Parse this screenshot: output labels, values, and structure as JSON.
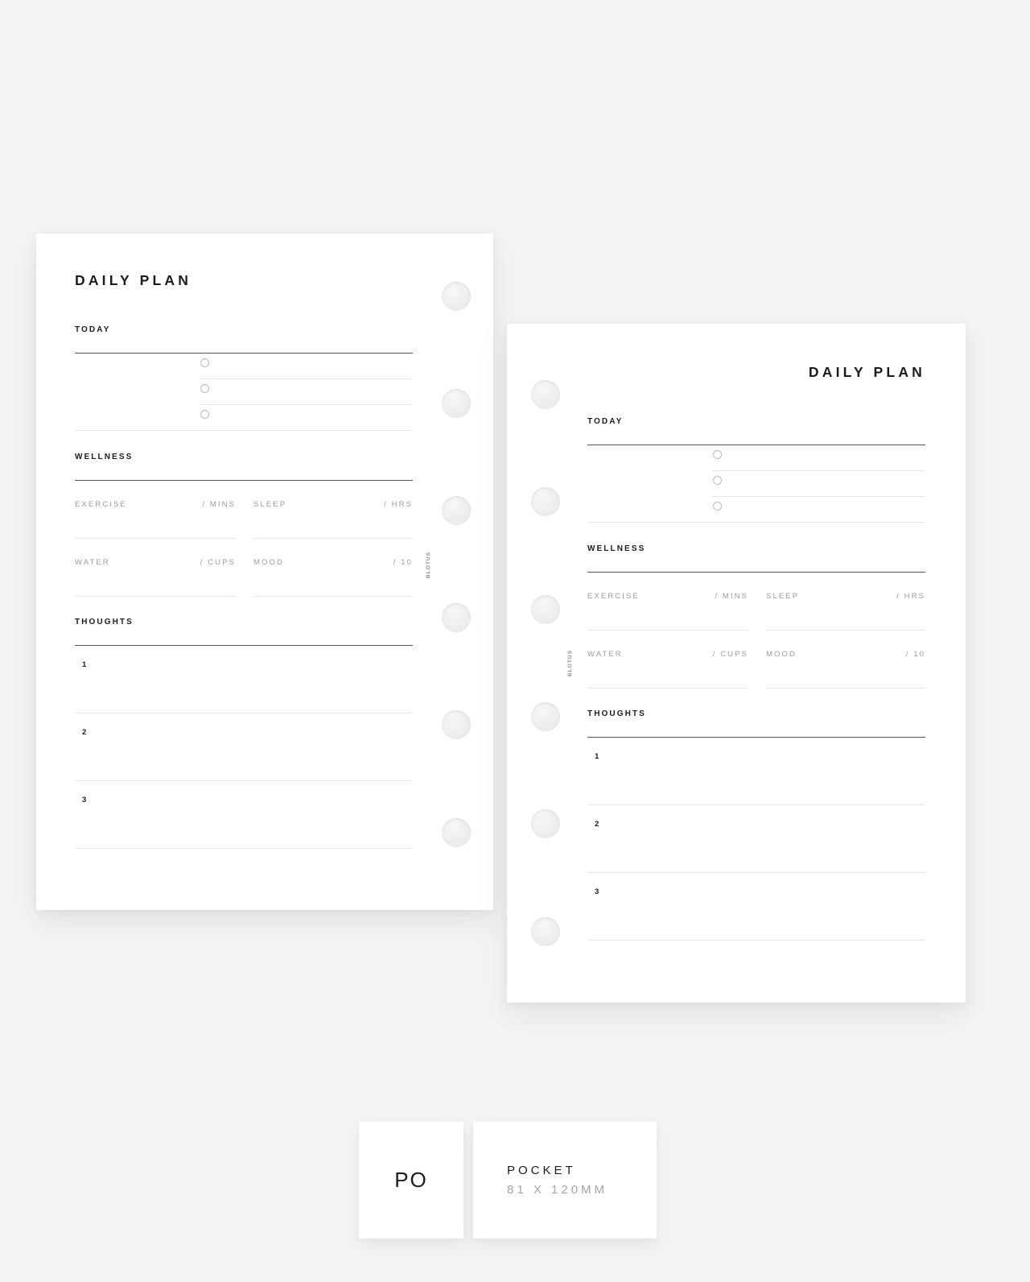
{
  "background_color": "#f5f4f3",
  "page_color": "#ffffff",
  "accent_rule_color": "#555555",
  "soft_rule_color": "#e6e6e6",
  "muted_text_color": "#9b9b9b",
  "pages": [
    {
      "id": "left",
      "title": "DAILY PLAN",
      "title_align": "left",
      "brand": "BLOTUS",
      "holes": 6,
      "sections": {
        "today": {
          "label": "TODAY",
          "rows": [
            {
              "checkbox": "radio-unchecked"
            },
            {
              "checkbox": "radio-unchecked"
            },
            {
              "checkbox": "radio-unchecked"
            }
          ]
        },
        "wellness": {
          "label": "WELLNESS",
          "fields": [
            {
              "label": "EXERCISE",
              "unit": "/ MINS"
            },
            {
              "label": "SLEEP",
              "unit": "/ HRS"
            },
            {
              "label": "WATER",
              "unit": "/ CUPS"
            },
            {
              "label": "MOOD",
              "unit": "/ 10"
            }
          ]
        },
        "thoughts": {
          "label": "THOUGHTS",
          "items": [
            "1",
            "2",
            "3"
          ]
        }
      }
    },
    {
      "id": "right",
      "title": "DAILY PLAN",
      "title_align": "right",
      "brand": "BLOTUS",
      "holes": 6,
      "sections": {
        "today": {
          "label": "TODAY",
          "rows": [
            {
              "checkbox": "radio-unchecked"
            },
            {
              "checkbox": "radio-unchecked"
            },
            {
              "checkbox": "radio-unchecked"
            }
          ]
        },
        "wellness": {
          "label": "WELLNESS",
          "fields": [
            {
              "label": "EXERCISE",
              "unit": "/ MINS"
            },
            {
              "label": "SLEEP",
              "unit": "/ HRS"
            },
            {
              "label": "WATER",
              "unit": "/ CUPS"
            },
            {
              "label": "MOOD",
              "unit": "/ 10"
            }
          ]
        },
        "thoughts": {
          "label": "THOUGHTS",
          "items": [
            "1",
            "2",
            "3"
          ]
        }
      }
    }
  ],
  "footer": {
    "code": "PO",
    "size_name": "POCKET",
    "size_dims": "81 X 120MM"
  }
}
